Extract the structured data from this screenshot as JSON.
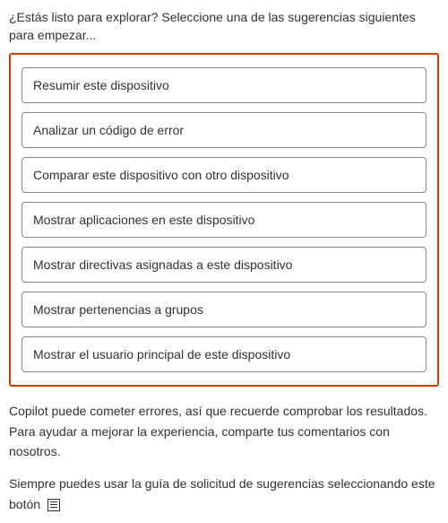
{
  "intro": "¿Estás listo para explorar? Seleccione una de las sugerencias siguientes para empezar...",
  "suggestions": [
    {
      "label": "Resumir este dispositivo"
    },
    {
      "label": "Analizar un código de error"
    },
    {
      "label": "Comparar este dispositivo con otro dispositivo"
    },
    {
      "label": "Mostrar aplicaciones en este dispositivo"
    },
    {
      "label": "Mostrar directivas asignadas a este dispositivo"
    },
    {
      "label": "Mostrar pertenencias a grupos"
    },
    {
      "label": "Mostrar el usuario principal de este dispositivo"
    }
  ],
  "disclaimer": "Copilot puede cometer errores, así que recuerde comprobar los resultados. Para ayudar a mejorar la experiencia, comparte tus comentarios con nosotros.",
  "guide_prefix": "Siempre puedes usar la guía de solicitud de sugerencias seleccionando este botón",
  "colors": {
    "highlight_border": "#d83b01",
    "item_border": "#8a8886",
    "text": "#323130"
  }
}
